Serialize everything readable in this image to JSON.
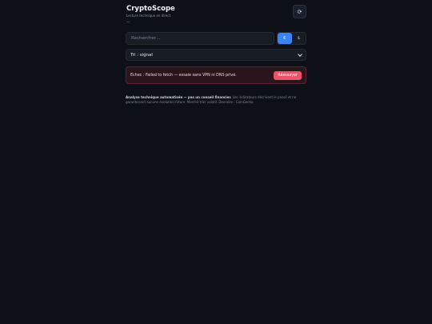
{
  "app": {
    "title": "CryptoScope",
    "subtitle": "Lecture technique en direct",
    "status_text": "—"
  },
  "toolbar": {
    "refresh_icon": "refresh-icon",
    "refresh_glyph": "⟳"
  },
  "search": {
    "placeholder": "Rechercher…",
    "value": ""
  },
  "currency": {
    "options": [
      "€",
      "$"
    ],
    "selected": "€"
  },
  "sort": {
    "label": "Tri : signal"
  },
  "error": {
    "message": "Echec : Failed to fetch — essaie sans VPN ni DNS privé.",
    "retry_label": "Réessayer"
  },
  "disclaimer": {
    "bold": "Analyse technique automatisée — pas un conseil financier.",
    "text": " Les indicateurs décrivent le passé et ne garantissent aucune évolution future. Marché très volatil. Données : CoinGecko."
  },
  "colors": {
    "background": "#0d1017",
    "accent": "#3b82f6",
    "error_button": "#f0506a"
  }
}
